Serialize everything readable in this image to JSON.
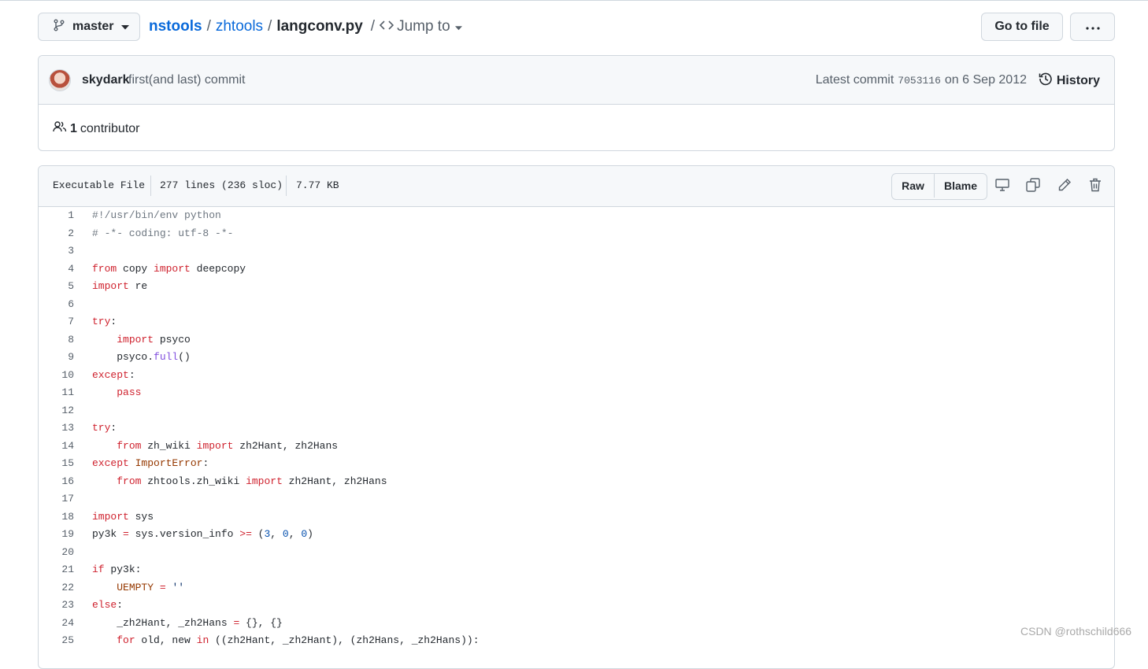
{
  "breadcrumb": {
    "branch": "master",
    "repo": "nstools",
    "folder": "zhtools",
    "file": "langconv.py",
    "separator": "/",
    "jump_to": "Jump to"
  },
  "actions": {
    "go_to_file": "Go to file"
  },
  "commit": {
    "author": "skydark",
    "message": "first(and last) commit",
    "latest_prefix": "Latest commit",
    "sha": "7053116",
    "date": "on 6 Sep 2012",
    "history_label": "History"
  },
  "contributors": {
    "count": "1",
    "label": "contributor"
  },
  "file_info": {
    "type": "Executable File",
    "lines": "277 lines (236 sloc)",
    "size": "7.77 KB",
    "raw_label": "Raw",
    "blame_label": "Blame"
  },
  "code_lines": [
    {
      "n": "1",
      "t": [
        [
          "c",
          "#!/usr/bin/env python"
        ]
      ]
    },
    {
      "n": "2",
      "t": [
        [
          "c",
          "# -*- coding: utf-8 -*-"
        ]
      ]
    },
    {
      "n": "3",
      "t": []
    },
    {
      "n": "4",
      "t": [
        [
          "k",
          "from"
        ],
        [
          "p",
          " copy "
        ],
        [
          "k",
          "import"
        ],
        [
          "p",
          " deepcopy"
        ]
      ]
    },
    {
      "n": "5",
      "t": [
        [
          "k",
          "import"
        ],
        [
          "p",
          " re"
        ]
      ]
    },
    {
      "n": "6",
      "t": []
    },
    {
      "n": "7",
      "t": [
        [
          "k",
          "try"
        ],
        [
          "p",
          ":"
        ]
      ]
    },
    {
      "n": "8",
      "t": [
        [
          "p",
          "    "
        ],
        [
          "k",
          "import"
        ],
        [
          "p",
          " psyco"
        ]
      ]
    },
    {
      "n": "9",
      "t": [
        [
          "p",
          "    psyco."
        ],
        [
          "f",
          "full"
        ],
        [
          "p",
          "()"
        ]
      ]
    },
    {
      "n": "10",
      "t": [
        [
          "k",
          "except"
        ],
        [
          "p",
          ":"
        ]
      ]
    },
    {
      "n": "11",
      "t": [
        [
          "p",
          "    "
        ],
        [
          "k",
          "pass"
        ]
      ]
    },
    {
      "n": "12",
      "t": []
    },
    {
      "n": "13",
      "t": [
        [
          "k",
          "try"
        ],
        [
          "p",
          ":"
        ]
      ]
    },
    {
      "n": "14",
      "t": [
        [
          "p",
          "    "
        ],
        [
          "k",
          "from"
        ],
        [
          "p",
          " zh_wiki "
        ],
        [
          "k",
          "import"
        ],
        [
          "p",
          " zh2Hant, zh2Hans"
        ]
      ]
    },
    {
      "n": "15",
      "t": [
        [
          "k",
          "except"
        ],
        [
          "p",
          " "
        ],
        [
          "cls",
          "ImportError"
        ],
        [
          "p",
          ":"
        ]
      ]
    },
    {
      "n": "16",
      "t": [
        [
          "p",
          "    "
        ],
        [
          "k",
          "from"
        ],
        [
          "p",
          " zhtools.zh_wiki "
        ],
        [
          "k",
          "import"
        ],
        [
          "p",
          " zh2Hant, zh2Hans"
        ]
      ]
    },
    {
      "n": "17",
      "t": []
    },
    {
      "n": "18",
      "t": [
        [
          "k",
          "import"
        ],
        [
          "p",
          " sys"
        ]
      ]
    },
    {
      "n": "19",
      "t": [
        [
          "p",
          "py3k "
        ],
        [
          "k",
          "="
        ],
        [
          "p",
          " sys.version_info "
        ],
        [
          "k",
          ">="
        ],
        [
          "p",
          " ("
        ],
        [
          "n",
          "3"
        ],
        [
          "p",
          ", "
        ],
        [
          "n",
          "0"
        ],
        [
          "p",
          ", "
        ],
        [
          "n",
          "0"
        ],
        [
          "p",
          ")"
        ]
      ]
    },
    {
      "n": "20",
      "t": []
    },
    {
      "n": "21",
      "t": [
        [
          "k",
          "if"
        ],
        [
          "p",
          " py3k:"
        ]
      ]
    },
    {
      "n": "22",
      "t": [
        [
          "p",
          "    "
        ],
        [
          "cls",
          "UEMPTY"
        ],
        [
          "p",
          " "
        ],
        [
          "k",
          "="
        ],
        [
          "p",
          " "
        ],
        [
          "s",
          "''"
        ]
      ]
    },
    {
      "n": "23",
      "t": [
        [
          "k",
          "else"
        ],
        [
          "p",
          ":"
        ]
      ]
    },
    {
      "n": "24",
      "t": [
        [
          "p",
          "    _zh2Hant, _zh2Hans "
        ],
        [
          "k",
          "="
        ],
        [
          "p",
          " {}, {}"
        ]
      ]
    },
    {
      "n": "25",
      "t": [
        [
          "p",
          "    "
        ],
        [
          "k",
          "for"
        ],
        [
          "p",
          " old, new "
        ],
        [
          "k",
          "in"
        ],
        [
          "p",
          " ((zh2Hant, _zh2Hant), (zh2Hans, _zh2Hans)):"
        ]
      ]
    }
  ],
  "watermark": "CSDN @rothschild666"
}
